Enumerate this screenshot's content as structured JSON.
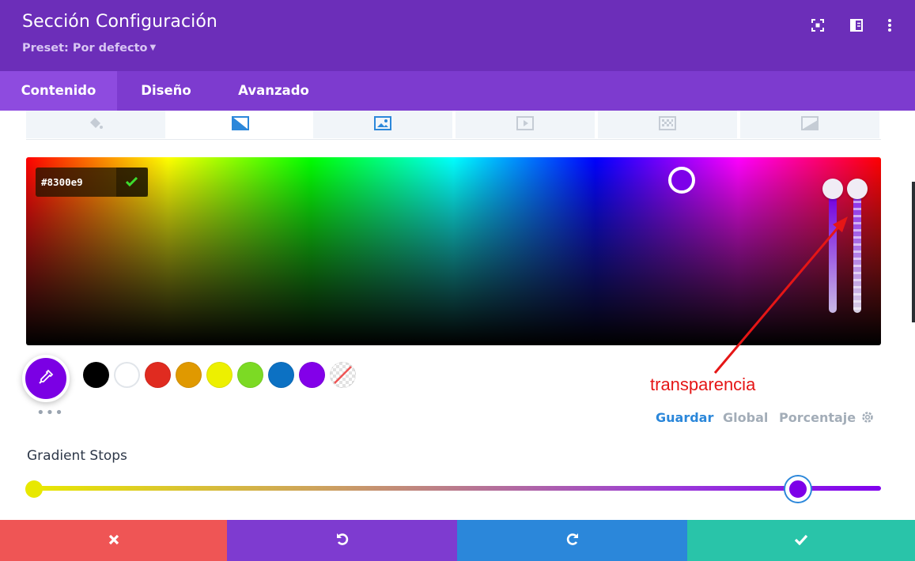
{
  "header": {
    "title": "Sección Configuración",
    "preset_label": "Preset: Por defecto",
    "bg_color": "#6c2eb9",
    "icons": [
      "expand-icon",
      "split-view-icon",
      "more-vertical-icon"
    ]
  },
  "tabs": [
    {
      "label": "Contenido",
      "active": true
    },
    {
      "label": "Diseño",
      "active": false
    },
    {
      "label": "Avanzado",
      "active": false
    }
  ],
  "background_tabs": [
    {
      "icon": "paint-bucket-icon",
      "active": false
    },
    {
      "icon": "gradient-icon",
      "active": true
    },
    {
      "icon": "image-icon",
      "active": false
    },
    {
      "icon": "video-icon",
      "active": false
    },
    {
      "icon": "pattern-icon",
      "active": false
    },
    {
      "icon": "mask-icon",
      "active": false
    }
  ],
  "color_picker": {
    "hex_value": "#8300e9",
    "selected_color": "#8300e9"
  },
  "annotation": {
    "text": "transparencia",
    "color": "#e51616"
  },
  "swatches": [
    "#000000",
    "#ffffff",
    "#e02b20",
    "#e09900",
    "#edf000",
    "#7cda24",
    "#0c71c3",
    "#8300e9",
    "transparent"
  ],
  "palette_actions": {
    "save": "Guardar",
    "global": "Global",
    "percentage": "Porcentaje"
  },
  "gradient": {
    "label": "Gradient Stops",
    "stops": [
      {
        "color": "#e8e800",
        "position": 0
      },
      {
        "color": "#7d00e8",
        "position": 90
      }
    ]
  },
  "footer": {
    "buttons": [
      {
        "name": "cancel",
        "icon": "close-icon",
        "color": "#ef5555"
      },
      {
        "name": "undo",
        "icon": "undo-icon",
        "color": "#7e3bd0"
      },
      {
        "name": "redo",
        "icon": "redo-icon",
        "color": "#2b87da"
      },
      {
        "name": "save",
        "icon": "check-icon",
        "color": "#29c4a9"
      }
    ]
  }
}
